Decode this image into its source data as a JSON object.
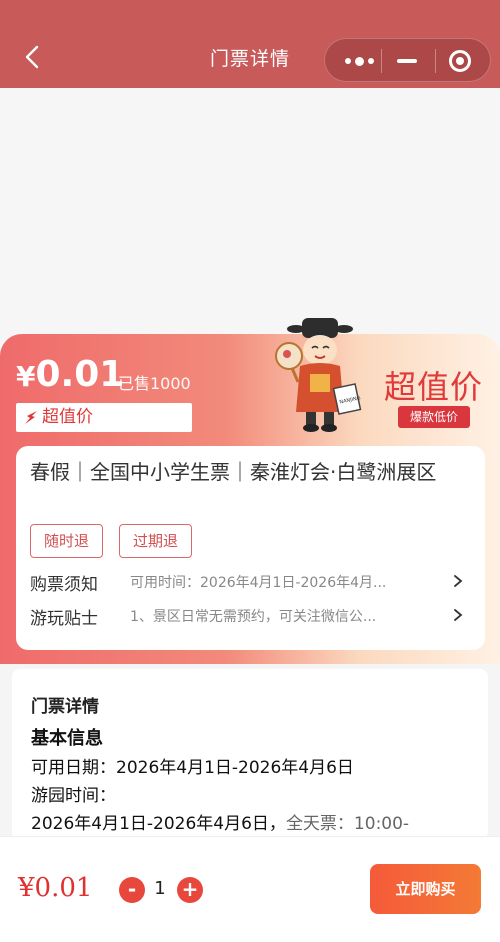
{
  "header": {
    "title": "门票详情"
  },
  "price_block": {
    "price": "0.01",
    "currency": "¥",
    "sold": "已售1000",
    "tag": "超值价",
    "promo_title": "超值价",
    "promo_badge": "爆款低价"
  },
  "ticket": {
    "title": "春假｜全国中小学生票｜秦淮灯会·白鹭洲展区",
    "chips": [
      "随时退",
      "过期退"
    ],
    "rows": [
      {
        "label": "购票须知",
        "value": "可用时间：2026年4月1日-2026年4月..."
      },
      {
        "label": "游玩贴士",
        "value": "1、景区日常无需预约，可关注微信公..."
      }
    ]
  },
  "detail": {
    "heading": "门票详情",
    "subheading": "基本信息",
    "available_dates": "可用日期：2026年4月1日-2026年4月6日",
    "park_time_label": "游园时间：",
    "park_time_value": "2026年4月1日-2026年4月6日，",
    "park_time_extra": "全天票：10:00-"
  },
  "bottom_bar": {
    "price": "¥0.01",
    "minus": "-",
    "quantity": "1",
    "plus": "+",
    "buy_label": "立即购买"
  },
  "colors": {
    "header": "#c85a5a",
    "accent": "#e03a3a",
    "buy_button": "#f55a3a"
  }
}
